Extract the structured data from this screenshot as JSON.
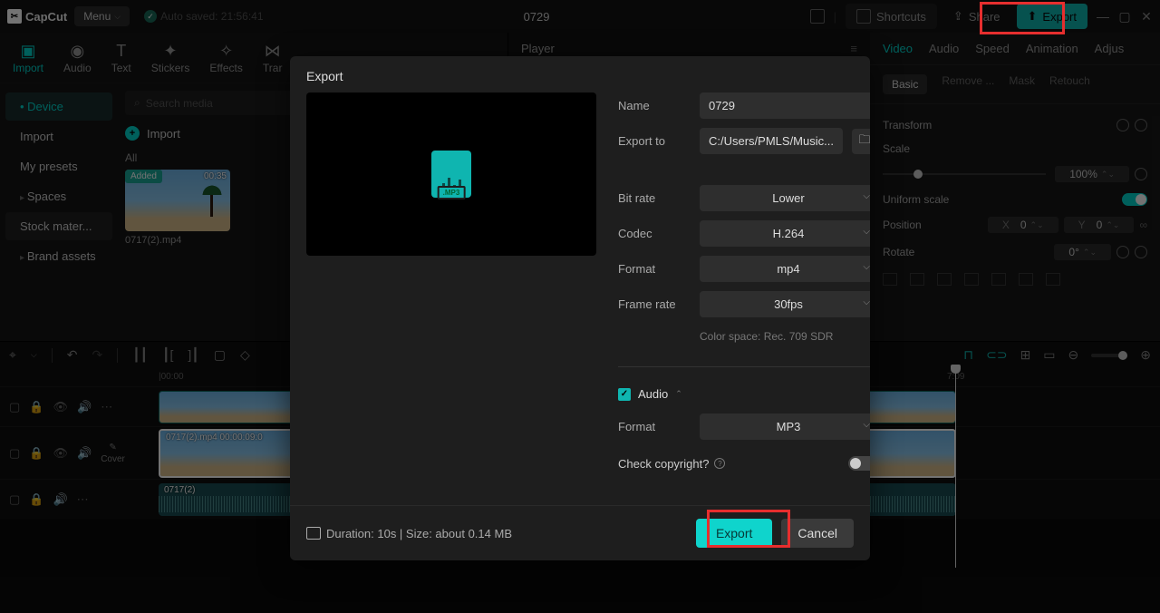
{
  "topbar": {
    "app_name": "CapCut",
    "menu_label": "Menu",
    "autosave_label": "Auto saved: 21:56:41",
    "project_title": "0729",
    "shortcuts_label": "Shortcuts",
    "share_label": "Share",
    "export_label": "Export"
  },
  "media_tabs": {
    "import": "Import",
    "audio": "Audio",
    "text": "Text",
    "stickers": "Stickers",
    "effects": "Effects",
    "transitions": "Trar"
  },
  "media_sidebar": {
    "device": "Device",
    "import": "Import",
    "my_presets": "My presets",
    "spaces": "Spaces",
    "stock": "Stock mater...",
    "brand": "Brand assets"
  },
  "media_content": {
    "search_placeholder": "Search media",
    "import_label": "Import",
    "all_label": "All",
    "clip_added": "Added",
    "clip_duration": "00:35",
    "clip_name": "0717(2).mp4"
  },
  "player": {
    "label": "Player"
  },
  "right_panel": {
    "tabs": {
      "video": "Video",
      "audio": "Audio",
      "speed": "Speed",
      "animation": "Animation",
      "adjust": "Adjus"
    },
    "subtabs": {
      "basic": "Basic",
      "remove": "Remove ...",
      "mask": "Mask",
      "retouch": "Retouch"
    },
    "transform_label": "Transform",
    "scale_label": "Scale",
    "scale_value": "100%",
    "uniform_label": "Uniform scale",
    "position_label": "Position",
    "pos_x_label": "X",
    "pos_x_value": "0",
    "pos_y_label": "Y",
    "pos_y_value": "0",
    "rotate_label": "Rotate",
    "rotate_value": "0°"
  },
  "timeline": {
    "ruler_start": "|00:00",
    "playhead_time": "7:09",
    "cover_label": "Cover",
    "video_track1_label": "",
    "video_track2_label": "0717(2).mp4  00:00:09:0",
    "audio_track_label": "0717(2)"
  },
  "modal": {
    "title": "Export",
    "name_label": "Name",
    "name_value": "0729",
    "exportto_label": "Export to",
    "exportto_value": "C:/Users/PMLS/Music...",
    "bitrate_label": "Bit rate",
    "bitrate_value": "Lower",
    "codec_label": "Codec",
    "codec_value": "H.264",
    "format_label": "Format",
    "format_value": "mp4",
    "framerate_label": "Frame rate",
    "framerate_value": "30fps",
    "colorspace_label": "Color space: Rec. 709 SDR",
    "audio_label": "Audio",
    "audio_format_label": "Format",
    "audio_format_value": "MP3",
    "copyright_label": "Check copyright?",
    "footer_info": "Duration: 10s | Size: about 0.14 MB",
    "export_btn": "Export",
    "cancel_btn": "Cancel",
    "mp3_badge": ".MP3"
  }
}
